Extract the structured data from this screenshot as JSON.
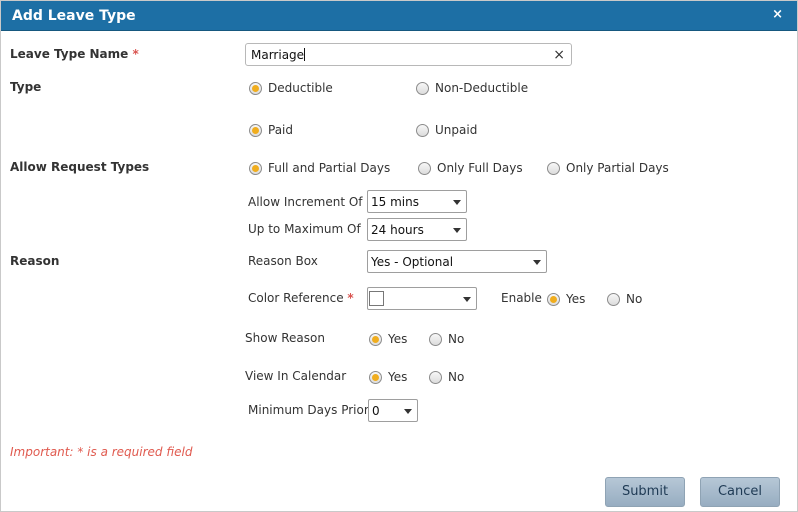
{
  "dialog": {
    "title": "Add Leave Type",
    "close_symbol": "×"
  },
  "fields": {
    "leave_type_name": {
      "label": "Leave Type Name",
      "required_mark": "*",
      "value": "Marriage",
      "clear_symbol": "×"
    },
    "type": {
      "label": "Type",
      "group1": [
        {
          "label": "Deductible",
          "checked": true
        },
        {
          "label": "Non-Deductible",
          "checked": false
        }
      ],
      "group2": [
        {
          "label": "Paid",
          "checked": true
        },
        {
          "label": "Unpaid",
          "checked": false
        }
      ]
    },
    "allow_request_types": {
      "label": "Allow Request Types",
      "options": [
        {
          "label": "Full and Partial Days",
          "checked": true
        },
        {
          "label": "Only Full Days",
          "checked": false
        },
        {
          "label": "Only Partial Days",
          "checked": false
        }
      ]
    },
    "allow_increment": {
      "label": "Allow Increment Of",
      "value": "15 mins"
    },
    "up_to_maximum": {
      "label": "Up to Maximum Of",
      "value": "24 hours"
    },
    "reason": {
      "label": "Reason",
      "reason_box": {
        "label": "Reason Box",
        "value": "Yes - Optional"
      }
    },
    "color_reference": {
      "label": "Color Reference",
      "required_mark": "*",
      "swatch_color": "#ffffff",
      "enable": {
        "label": "Enable",
        "options": [
          {
            "label": "Yes",
            "checked": true
          },
          {
            "label": "No",
            "checked": false
          }
        ]
      }
    },
    "show_reason": {
      "label": "Show Reason",
      "options": [
        {
          "label": "Yes",
          "checked": true
        },
        {
          "label": "No",
          "checked": false
        }
      ]
    },
    "view_in_calendar": {
      "label": "View In Calendar",
      "options": [
        {
          "label": "Yes",
          "checked": true
        },
        {
          "label": "No",
          "checked": false
        }
      ]
    },
    "minimum_days_prior": {
      "label": "Minimum Days Prior",
      "value": "0"
    }
  },
  "note": "Important: * is a required field",
  "buttons": {
    "submit": "Submit",
    "cancel": "Cancel"
  },
  "colors": {
    "titlebar": "#1d6fa5",
    "radio_checked": "#f0ad1e",
    "required": "#d9534f",
    "button": "#a8bccd"
  }
}
